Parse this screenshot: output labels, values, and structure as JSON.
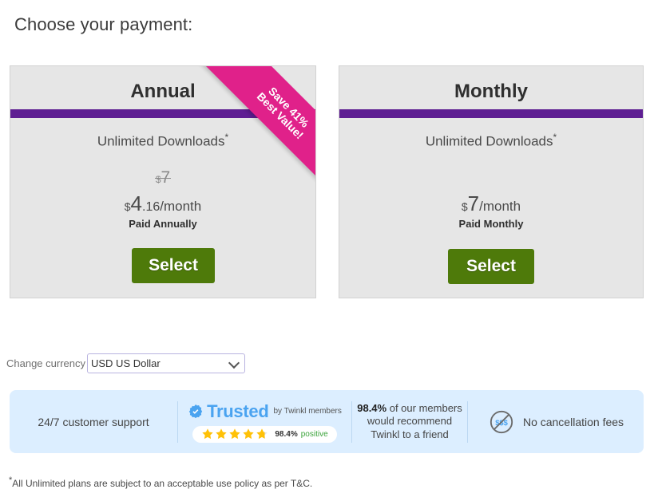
{
  "page": {
    "title": "Choose your payment:"
  },
  "plans": [
    {
      "id": "annual",
      "title": "Annual",
      "feature": "Unlimited Downloads",
      "feature_asterisk": "*",
      "old_price_currency": "$",
      "old_price_amount": "7",
      "price_currency": "$",
      "price_whole": "4",
      "price_decimal": ".16",
      "price_period": "/month",
      "billing_note": "Paid Annually",
      "select_label": "Select",
      "ribbon_line1": "Save 41%",
      "ribbon_line2": "Best Value!"
    },
    {
      "id": "monthly",
      "title": "Monthly",
      "feature": "Unlimited Downloads",
      "feature_asterisk": "*",
      "price_currency": "$",
      "price_whole": "7",
      "price_period": "/month",
      "billing_note": "Paid Monthly",
      "select_label": "Select"
    }
  ],
  "currency": {
    "label": "Change currency",
    "selected": "USD US Dollar",
    "options": [
      "USD US Dollar"
    ]
  },
  "trust_bar": {
    "support": "24/7 customer support",
    "trusted_word": "Trusted",
    "trusted_by": "by Twinkl members",
    "rating_percent": "98.4%",
    "rating_word": "positive",
    "stars_filled": 4.75,
    "recommend_percent": "98.4%",
    "recommend_rest": " of our members would recommend Twinkl to a friend",
    "no_fees": "No cancellation fees",
    "no_fees_icon_text": "$$$"
  },
  "footnote": {
    "asterisk": "*",
    "text": "All Unlimited plans are subject to an acceptable use policy as per T&C."
  },
  "colors": {
    "purple_bar": "#5e1e92",
    "ribbon": "#e0218a",
    "select_button": "#4e7a0a",
    "card_bg": "#e6e6e6",
    "trust_bg": "#dceeff",
    "trusted_blue": "#4aa3f0",
    "positive_green": "#3aa33a",
    "star": "#ffc107"
  }
}
